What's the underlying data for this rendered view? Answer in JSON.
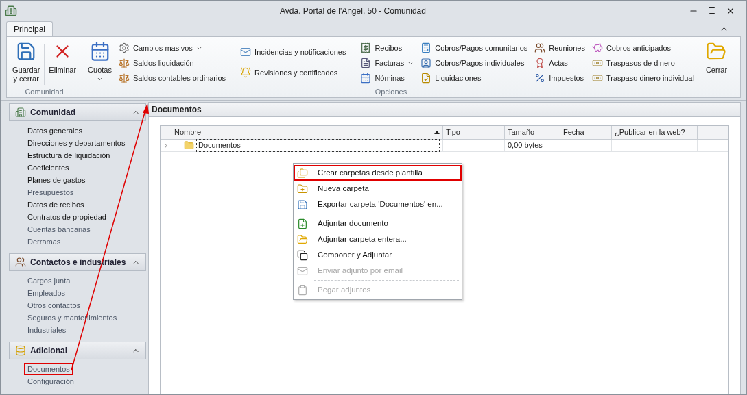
{
  "window": {
    "title": "Avda. Portal de l'Angel, 50 - Comunidad"
  },
  "ribbon": {
    "tabs": [
      {
        "label": "Principal",
        "selected": true
      }
    ],
    "groups": [
      {
        "label": "Comunidad",
        "large": [
          {
            "label": "Guardar\ny cerrar",
            "dropdown": false
          },
          {
            "label": "Eliminar",
            "dropdown": false
          }
        ]
      },
      {
        "label": "Opciones",
        "large": [
          {
            "label": "Cuotas",
            "dropdown": true
          }
        ],
        "columns": [
          [
            {
              "label": "Cambios masivos",
              "dropdown": true
            },
            {
              "label": "Saldos liquidación",
              "dropdown": false
            },
            {
              "label": "Saldos contables ordinarios",
              "dropdown": false
            }
          ],
          [
            {
              "label": "Incidencias y notificaciones",
              "dropdown": false
            },
            {
              "label": "Revisiones y certificados",
              "dropdown": false
            }
          ],
          [
            {
              "label": "Recibos",
              "dropdown": false
            },
            {
              "label": "Facturas",
              "dropdown": true
            },
            {
              "label": "Nóminas",
              "dropdown": false
            }
          ],
          [
            {
              "label": "Cobros/Pagos comunitarios",
              "dropdown": false
            },
            {
              "label": "Cobros/Pagos individuales",
              "dropdown": false
            },
            {
              "label": "Liquidaciones",
              "dropdown": false
            }
          ],
          [
            {
              "label": "Reuniones",
              "dropdown": false
            },
            {
              "label": "Actas",
              "dropdown": false
            },
            {
              "label": "Impuestos",
              "dropdown": false
            }
          ],
          [
            {
              "label": "Cobros anticipados",
              "dropdown": false
            },
            {
              "label": "Traspasos de dinero",
              "dropdown": false
            },
            {
              "label": "Traspaso dinero individual",
              "dropdown": false
            }
          ]
        ]
      },
      {
        "large": [
          {
            "label": "Cerrar",
            "dropdown": false
          }
        ]
      }
    ]
  },
  "sidebar": {
    "sections": [
      {
        "title": "Comunidad",
        "expanded": true,
        "items": [
          {
            "label": "Datos generales",
            "dimmed": false,
            "highlighted": false
          },
          {
            "label": "Direcciones y departamentos",
            "dimmed": false,
            "highlighted": false
          },
          {
            "label": "Estructura de liquidación",
            "dimmed": false,
            "highlighted": false
          },
          {
            "label": "Coeficientes",
            "dimmed": false,
            "highlighted": false
          },
          {
            "label": "Planes de gastos",
            "dimmed": false,
            "highlighted": false
          },
          {
            "label": "Presupuestos",
            "dimmed": true,
            "highlighted": false
          },
          {
            "label": "Datos de recibos",
            "dimmed": false,
            "highlighted": false
          },
          {
            "label": "Contratos de propiedad",
            "dimmed": false,
            "highlighted": false
          },
          {
            "label": "Cuentas bancarias",
            "dimmed": true,
            "highlighted": false
          },
          {
            "label": "Derramas",
            "dimmed": true,
            "highlighted": false
          }
        ]
      },
      {
        "title": "Contactos e industriales",
        "expanded": true,
        "items": [
          {
            "label": "Cargos junta",
            "dimmed": true,
            "highlighted": false
          },
          {
            "label": "Empleados",
            "dimmed": true,
            "highlighted": false
          },
          {
            "label": "Otros contactos",
            "dimmed": true,
            "highlighted": false
          },
          {
            "label": "Seguros y mantenimientos",
            "dimmed": true,
            "highlighted": false
          },
          {
            "label": "Industriales",
            "dimmed": true,
            "highlighted": false
          }
        ]
      },
      {
        "title": "Adicional",
        "expanded": true,
        "items": [
          {
            "label": "Documentos",
            "dimmed": true,
            "highlighted": true
          },
          {
            "label": "Configuración",
            "dimmed": true,
            "highlighted": false
          }
        ]
      }
    ]
  },
  "content": {
    "title": "Documentos",
    "table": {
      "columns": [
        {
          "label": "Nombre",
          "sorted": true
        },
        {
          "label": "Tipo",
          "sorted": false
        },
        {
          "label": "Tamaño",
          "sorted": false
        },
        {
          "label": "Fecha",
          "sorted": false
        },
        {
          "label": "¿Publicar en la web?",
          "sorted": false
        }
      ],
      "rows": [
        {
          "cells": [
            "Documentos",
            "",
            "0,00 bytes",
            "",
            ""
          ],
          "selected": true
        }
      ]
    }
  },
  "context_menu": {
    "items": [
      {
        "kind": "item",
        "label": "Crear carpetas desde plantilla",
        "disabled": false,
        "highlighted": true
      },
      {
        "kind": "item",
        "label": "Nueva carpeta",
        "disabled": false,
        "highlighted": false
      },
      {
        "kind": "item",
        "label": "Exportar carpeta 'Documentos' en...",
        "disabled": false,
        "highlighted": false
      },
      {
        "kind": "separator"
      },
      {
        "kind": "item",
        "label": "Adjuntar documento",
        "disabled": false,
        "highlighted": false
      },
      {
        "kind": "item",
        "label": "Adjuntar carpeta entera...",
        "disabled": false,
        "highlighted": false
      },
      {
        "kind": "item",
        "label": "Componer y Adjuntar",
        "disabled": false,
        "highlighted": false
      },
      {
        "kind": "item",
        "label": "Enviar adjunto por email",
        "disabled": true,
        "highlighted": false
      },
      {
        "kind": "separator"
      },
      {
        "kind": "item",
        "label": "Pegar adjuntos",
        "disabled": true,
        "highlighted": false
      }
    ]
  }
}
